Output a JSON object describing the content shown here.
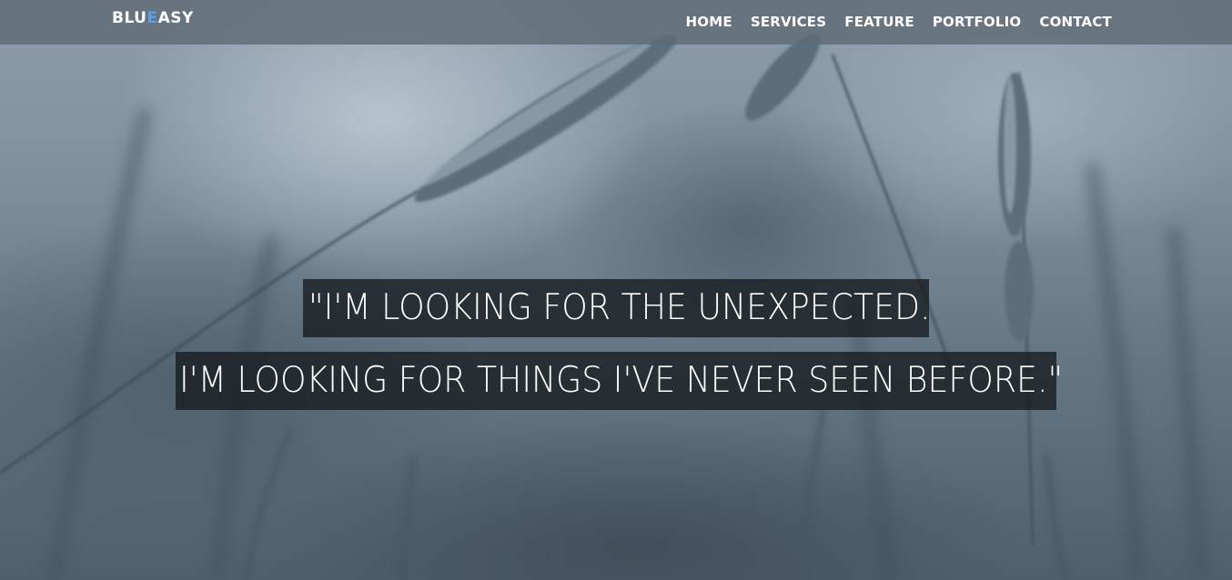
{
  "brand": {
    "prefix": "BLU",
    "accent": "E",
    "suffix": "ASY",
    "accent_color": "#5aa2e6"
  },
  "nav": {
    "items": [
      {
        "label": "HOME"
      },
      {
        "label": "SERVICES"
      },
      {
        "label": "FEATURE"
      },
      {
        "label": "PORTFOLIO"
      },
      {
        "label": "CONTACT"
      }
    ]
  },
  "hero": {
    "background": "blurred wheat field photo",
    "quote_line_1": "\"I'M LOOKING FOR THE UNEXPECTED.",
    "quote_line_2": "I'M LOOKING FOR THINGS I'VE NEVER SEEN BEFORE.\""
  },
  "colors": {
    "navbar_bg": "#5f6a74",
    "quote_bg": "#161a1e",
    "text": "#ffffff"
  }
}
